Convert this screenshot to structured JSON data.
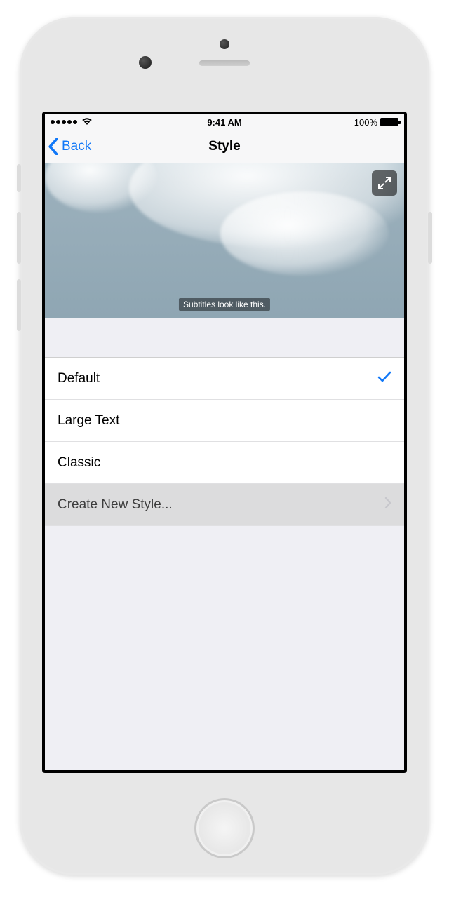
{
  "statusbar": {
    "time": "9:41 AM",
    "battery": "100%"
  },
  "nav": {
    "back": "Back",
    "title": "Style"
  },
  "preview": {
    "subtitle": "Subtitles look like this."
  },
  "styles": {
    "option0": "Default",
    "option1": "Large Text",
    "option2": "Classic",
    "create": "Create New Style...",
    "selected": 0
  },
  "colors": {
    "accent": "#1178f8"
  }
}
